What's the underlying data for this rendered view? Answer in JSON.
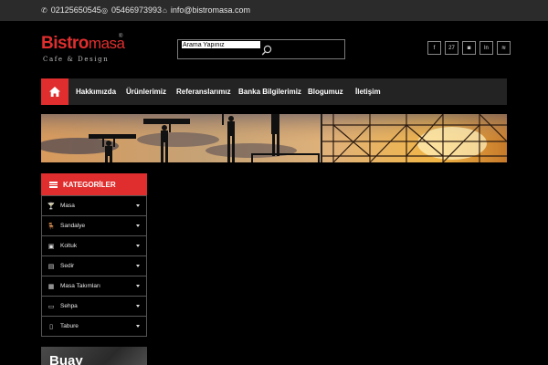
{
  "contact": {
    "phone": "02125650545",
    "whatsapp": "05466973993",
    "email": "info@bistromasa.com"
  },
  "logo": {
    "brand_bold": "Bistro",
    "brand_light": "masa",
    "reg_mark": "®",
    "tagline": "Cafe & Design"
  },
  "search": {
    "placeholder": "Arama Yapınız",
    "icon": "search-icon"
  },
  "social": [
    {
      "label": "f",
      "icon": "facebook-icon"
    },
    {
      "label": "27",
      "icon": "calendar-icon"
    },
    {
      "label": "◙",
      "icon": "instagram-icon"
    },
    {
      "label": "ln",
      "icon": "linkedin-icon"
    },
    {
      "label": "≋",
      "icon": "rss-icon"
    }
  ],
  "nav": {
    "home_icon": "home-icon",
    "items": [
      "Hakkımızda",
      "Ürünlerimiz",
      "Referanslarımız",
      "Banka Bilgilerimiz",
      "Blogumuz",
      "İletişim"
    ]
  },
  "sidebar": {
    "title": "KATEGORİLER",
    "items": [
      {
        "label": "Masa",
        "icon": "cocktail-icon",
        "glyph": "🍸"
      },
      {
        "label": "Sandalye",
        "icon": "chair-icon",
        "glyph": "🪑"
      },
      {
        "label": "Koltuk",
        "icon": "armchair-icon",
        "glyph": "▣"
      },
      {
        "label": "Sedir",
        "icon": "sofa-icon",
        "glyph": "▤"
      },
      {
        "label": "Masa Takımları",
        "icon": "table-set-icon",
        "glyph": "▦"
      },
      {
        "label": "Sehpa",
        "icon": "coffee-table-icon",
        "glyph": "▭"
      },
      {
        "label": "Tabure",
        "icon": "stool-icon",
        "glyph": "▯"
      }
    ]
  },
  "promo": {
    "text": "Buay"
  },
  "colors": {
    "accent": "#e02e2e",
    "topbar": "#2b2b2b",
    "nav": "#232323"
  }
}
